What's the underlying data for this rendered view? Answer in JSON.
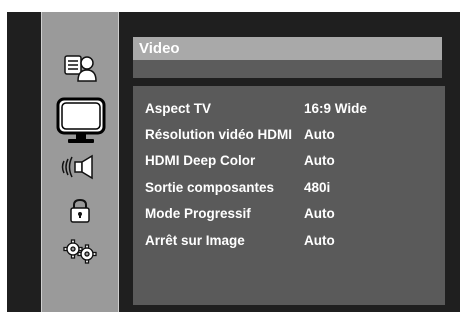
{
  "menu": {
    "title": "Video",
    "sidebar": [
      {
        "icon": "disc-person-icon",
        "selected": false
      },
      {
        "icon": "tv-monitor-icon",
        "selected": true
      },
      {
        "icon": "speaker-icon",
        "selected": false
      },
      {
        "icon": "lock-icon",
        "selected": false
      },
      {
        "icon": "gears-icon",
        "selected": false
      }
    ],
    "settings": [
      {
        "label": "Aspect TV",
        "value": "16:9 Wide"
      },
      {
        "label": "Résolution vidéo HDMI",
        "value": "Auto"
      },
      {
        "label": "HDMI Deep Color",
        "value": "Auto"
      },
      {
        "label": "Sortie composantes",
        "value": "480i"
      },
      {
        "label": "Mode Progressif",
        "value": "Auto"
      },
      {
        "label": "Arrêt sur Image",
        "value": "Auto"
      }
    ]
  },
  "colors": {
    "screen_bg": "#1f1f1f",
    "sidebar_bg": "#9a9a9a",
    "header_bg": "#a9a9a9",
    "content_bg": "#5a5a5a",
    "text": "#ffffff"
  }
}
